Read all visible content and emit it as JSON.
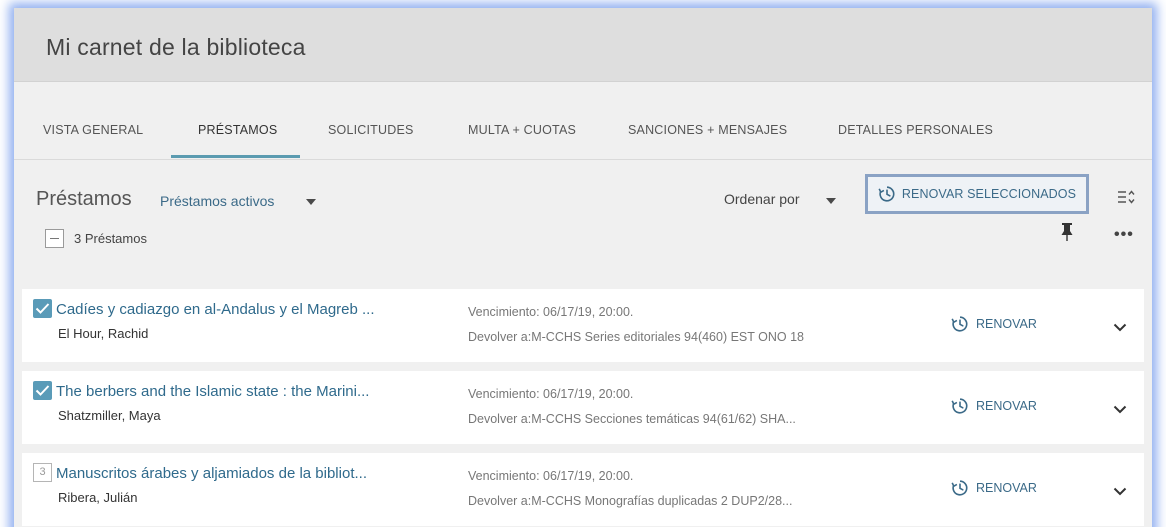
{
  "header": {
    "title": "Mi carnet de la biblioteca"
  },
  "tabs": [
    {
      "label": "VISTA GENERAL",
      "active": false
    },
    {
      "label": "PRÉSTAMOS",
      "active": true
    },
    {
      "label": "SOLICITUDES",
      "active": false
    },
    {
      "label": "MULTA + CUOTAS",
      "active": false
    },
    {
      "label": "SANCIONES + MENSAJES",
      "active": false
    },
    {
      "label": "DETALLES PERSONALES",
      "active": false
    }
  ],
  "loans_section": {
    "title": "Préstamos",
    "filter_label": "Préstamos activos",
    "sort_label": "Ordenar por",
    "renew_selected_label": "RENOVAR SELECCIONADOS",
    "count_label": "3 Préstamos"
  },
  "loans": [
    {
      "selected": true,
      "index": "",
      "title": "Cadíes y cadiazgo en al-Andalus y el Magreb ...",
      "author": "El Hour, Rachid",
      "due": "Vencimiento: 06/17/19, 20:00.",
      "return_to": "Devolver a:M-CCHS Series editoriales 94(460) EST ONO 18",
      "renew_label": "RENOVAR"
    },
    {
      "selected": true,
      "index": "",
      "title": "The berbers and the Islamic state : the Marini...",
      "author": "Shatzmiller, Maya",
      "due": "Vencimiento: 06/17/19, 20:00.",
      "return_to": "Devolver a:M-CCHS Secciones temáticas 94(61/62) SHA...",
      "renew_label": "RENOVAR"
    },
    {
      "selected": false,
      "index": "3",
      "title": "Manuscritos árabes y aljamiados de la bibliot...",
      "author": "Ribera, Julián",
      "due": "Vencimiento: 06/17/19, 20:00.",
      "return_to": "Devolver a:M-CCHS Monografías duplicadas 2 DUP2/28...",
      "renew_label": "RENOVAR"
    }
  ],
  "colors": {
    "accent": "#5b9bb0",
    "link": "#2f6a8c",
    "header_bg": "#dedede",
    "page_bg": "#f0f0f0"
  },
  "icons": {
    "renew": "renew-clock-icon",
    "sort_toggle": "sort-toggle-icon",
    "pin": "pin-icon",
    "more": "more-options-icon",
    "expand": "chevron-down-icon",
    "check": "check-icon"
  }
}
